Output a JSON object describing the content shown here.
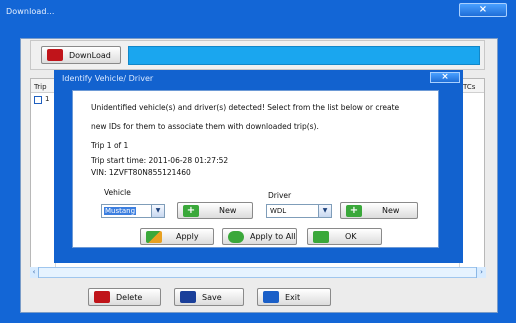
{
  "window": {
    "title": "Download...",
    "close_glyph": "×"
  },
  "download": {
    "button_label": "DownLoad",
    "progress": 1.0,
    "icon": "download-icon"
  },
  "grid": {
    "columns": [
      "Trip",
      "TCs"
    ],
    "rows": [
      {
        "checked": false,
        "trip": "1"
      }
    ]
  },
  "scroll": {
    "left_glyph": "‹",
    "right_glyph": "›"
  },
  "bottom_bar": {
    "delete_label": "Delete",
    "save_label": "Save",
    "exit_label": "Exit"
  },
  "dialog": {
    "title": "Identify Vehicle/ Driver",
    "close_glyph": "×",
    "message_line1": "Unidentified vehicle(s) and driver(s) detected! Select from the list below or create",
    "message_line2": "new IDs for them to associate them with downloaded trip(s).",
    "trip_counter": "Trip 1 of 1",
    "trip_start": "Trip start time:  2011-06-28 01:27:52",
    "vin": "VIN: 1ZVFT80N855121460",
    "vehicle_label": "Vehicle",
    "vehicle_value": "Mustang",
    "driver_label": "Driver",
    "driver_value": "WDL",
    "new_label": "New",
    "new_plus_glyph": "+",
    "apply_label": "Apply",
    "apply_all_label": "Apply to All",
    "ok_label": "OK",
    "dropdown_glyph": "▼"
  },
  "colors": {
    "window_blue": "#1366d6",
    "progress_cyan": "#1aa6ef",
    "plus_green": "#3aa83a",
    "delete_red": "#c0141a",
    "save_blue": "#1a3f9a",
    "exit_blue": "#1a5fc8"
  }
}
